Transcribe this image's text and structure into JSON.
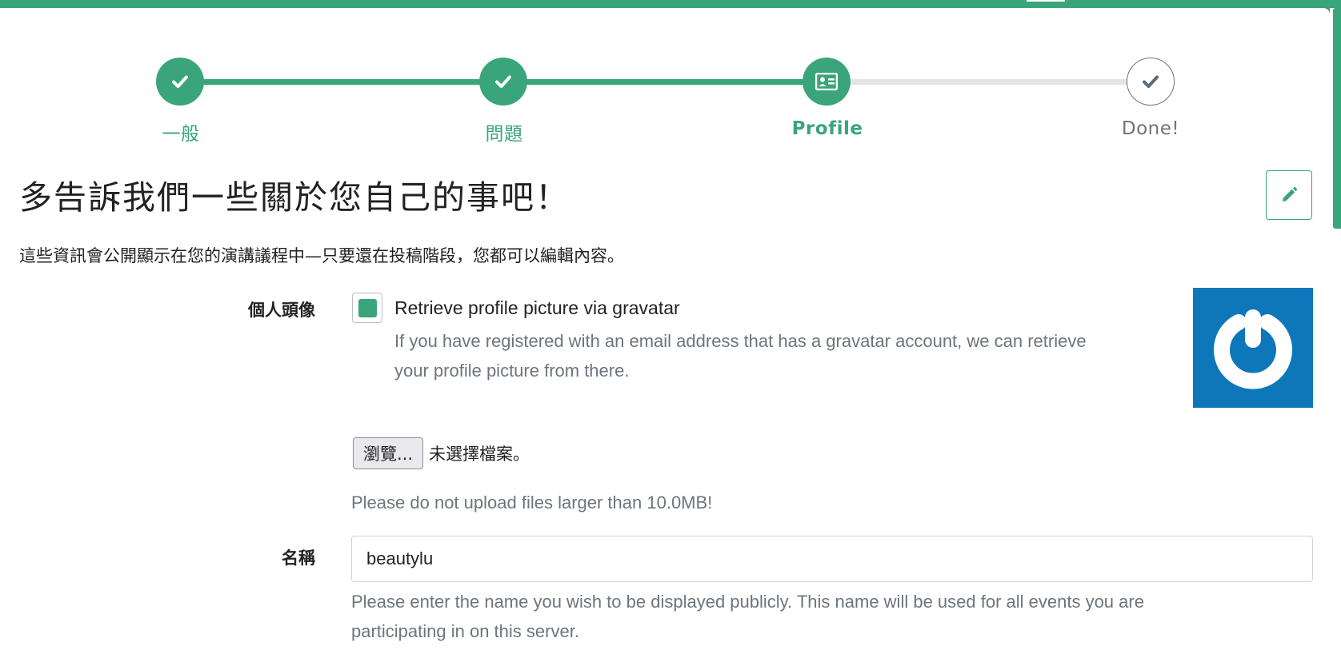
{
  "colors": {
    "primary": "#3aa57a",
    "muted": "#6c757d",
    "inactive_track": "#e1e5e8",
    "gravatar_blue": "#0e77b9"
  },
  "steps": [
    {
      "label": "一般",
      "state": "done",
      "icon": "check-icon"
    },
    {
      "label": "問題",
      "state": "done",
      "icon": "check-icon"
    },
    {
      "label": "Profile",
      "state": "current",
      "icon": "id-card-icon"
    },
    {
      "label": "Done!",
      "state": "pending",
      "icon": "check-icon"
    }
  ],
  "page": {
    "title": "多告訴我們一些關於您自己的事吧！",
    "intro": "這些資訊會公開顯示在您的演講議程中—只要還在投稿階段，您都可以編輯內容。",
    "edit_icon": "pencil-icon"
  },
  "avatar_field": {
    "label": "個人頭像",
    "checkbox_checked": true,
    "checkbox_label": "Retrieve profile picture via gravatar",
    "help_line1": "If you have registered with an email address that has a gravatar account, we can retrieve",
    "help_line2": "your profile picture from there.",
    "browse_label": "瀏覽...",
    "no_file_text": "未選擇檔案。",
    "upload_help": "Please do not upload files larger than 10.0MB!",
    "image_icon": "gravatar-logo-icon"
  },
  "name_field": {
    "label": "名稱",
    "value": "beautylu",
    "help_line1": "Please enter the name you wish to be displayed publicly. This name will be used for all events you are",
    "help_line2": "participating in on this server."
  }
}
